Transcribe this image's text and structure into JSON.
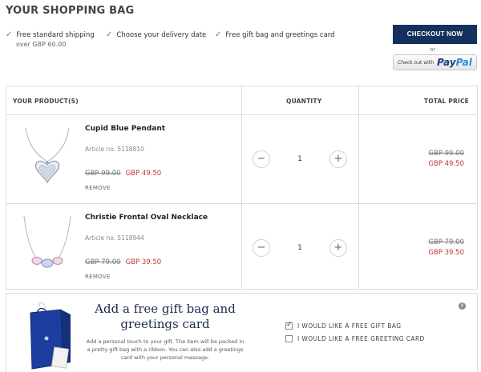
{
  "page_title": "YOUR SHOPPING BAG",
  "perks": [
    {
      "text": "Free standard shipping",
      "sub": "over GBP 60.00"
    },
    {
      "text": "Choose your delivery date",
      "sub": ""
    },
    {
      "text": "Free gift bag and greetings card",
      "sub": ""
    }
  ],
  "checkout_label": "CHECKOUT NOW",
  "or_label": "or",
  "paypal": {
    "prefix": "Check out with",
    "pay": "Pay",
    "pal": "Pal"
  },
  "table": {
    "headers": {
      "product": "YOUR PRODUCT(S)",
      "quantity": "QUANTITY",
      "total": "TOTAL PRICE"
    },
    "rows": [
      {
        "name": "Cupid Blue Pendant",
        "article": "Article no. 5118810",
        "old_price": "GBP 99.00",
        "new_price": "GBP 49.50",
        "remove": "REMOVE",
        "qty": "1",
        "minus": "−",
        "plus": "+",
        "total_old": "GBP 99.00",
        "total_new": "GBP 49.50"
      },
      {
        "name": "Christie Frontal Oval Necklace",
        "article": "Article no. 5118944",
        "old_price": "GBP 79.00",
        "new_price": "GBP 39.50",
        "remove": "REMOVE",
        "qty": "1",
        "minus": "−",
        "plus": "+",
        "total_old": "GBP 79.00",
        "total_new": "GBP 39.50"
      }
    ]
  },
  "gift": {
    "title": "Add a free gift bag and greetings card",
    "desc": "Add a personal touch to your gift. The item will be packed in a pretty gift bag with a ribbon. You can also add a greetings card with your personal message.",
    "options": [
      {
        "label": "I WOULD LIKE A FREE GIFT BAG",
        "checked": true
      },
      {
        "label": "I WOULD LIKE A FREE GREETING CARD",
        "checked": false
      }
    ],
    "info": "i"
  },
  "colors": {
    "navy": "#14305c",
    "price_red": "#c0392b",
    "check_green": "#3aa346"
  }
}
